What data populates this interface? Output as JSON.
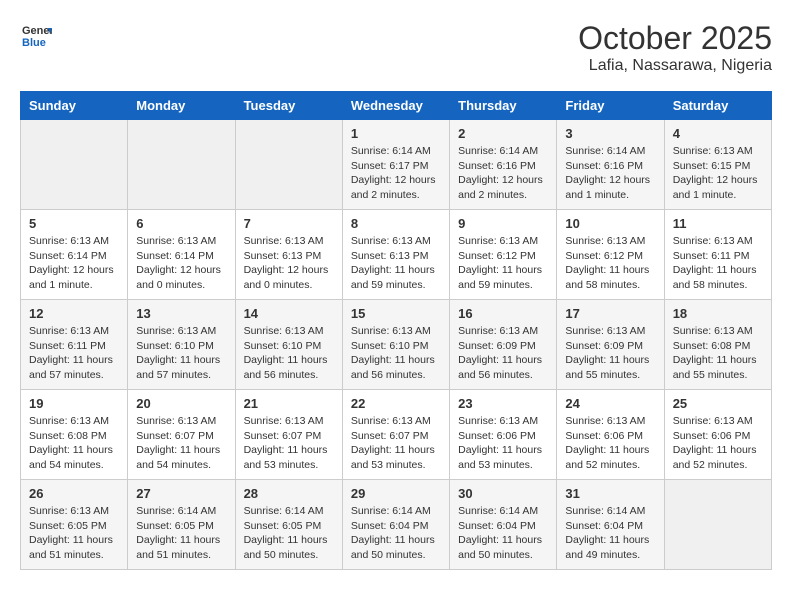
{
  "header": {
    "logo_general": "General",
    "logo_blue": "Blue",
    "title": "October 2025",
    "subtitle": "Lafia, Nassarawa, Nigeria"
  },
  "days_of_week": [
    "Sunday",
    "Monday",
    "Tuesday",
    "Wednesday",
    "Thursday",
    "Friday",
    "Saturday"
  ],
  "weeks": [
    [
      {
        "day": "",
        "info": ""
      },
      {
        "day": "",
        "info": ""
      },
      {
        "day": "",
        "info": ""
      },
      {
        "day": "1",
        "info": "Sunrise: 6:14 AM\nSunset: 6:17 PM\nDaylight: 12 hours\nand 2 minutes."
      },
      {
        "day": "2",
        "info": "Sunrise: 6:14 AM\nSunset: 6:16 PM\nDaylight: 12 hours\nand 2 minutes."
      },
      {
        "day": "3",
        "info": "Sunrise: 6:14 AM\nSunset: 6:16 PM\nDaylight: 12 hours\nand 1 minute."
      },
      {
        "day": "4",
        "info": "Sunrise: 6:13 AM\nSunset: 6:15 PM\nDaylight: 12 hours\nand 1 minute."
      }
    ],
    [
      {
        "day": "5",
        "info": "Sunrise: 6:13 AM\nSunset: 6:14 PM\nDaylight: 12 hours\nand 1 minute."
      },
      {
        "day": "6",
        "info": "Sunrise: 6:13 AM\nSunset: 6:14 PM\nDaylight: 12 hours\nand 0 minutes."
      },
      {
        "day": "7",
        "info": "Sunrise: 6:13 AM\nSunset: 6:13 PM\nDaylight: 12 hours\nand 0 minutes."
      },
      {
        "day": "8",
        "info": "Sunrise: 6:13 AM\nSunset: 6:13 PM\nDaylight: 11 hours\nand 59 minutes."
      },
      {
        "day": "9",
        "info": "Sunrise: 6:13 AM\nSunset: 6:12 PM\nDaylight: 11 hours\nand 59 minutes."
      },
      {
        "day": "10",
        "info": "Sunrise: 6:13 AM\nSunset: 6:12 PM\nDaylight: 11 hours\nand 58 minutes."
      },
      {
        "day": "11",
        "info": "Sunrise: 6:13 AM\nSunset: 6:11 PM\nDaylight: 11 hours\nand 58 minutes."
      }
    ],
    [
      {
        "day": "12",
        "info": "Sunrise: 6:13 AM\nSunset: 6:11 PM\nDaylight: 11 hours\nand 57 minutes."
      },
      {
        "day": "13",
        "info": "Sunrise: 6:13 AM\nSunset: 6:10 PM\nDaylight: 11 hours\nand 57 minutes."
      },
      {
        "day": "14",
        "info": "Sunrise: 6:13 AM\nSunset: 6:10 PM\nDaylight: 11 hours\nand 56 minutes."
      },
      {
        "day": "15",
        "info": "Sunrise: 6:13 AM\nSunset: 6:10 PM\nDaylight: 11 hours\nand 56 minutes."
      },
      {
        "day": "16",
        "info": "Sunrise: 6:13 AM\nSunset: 6:09 PM\nDaylight: 11 hours\nand 56 minutes."
      },
      {
        "day": "17",
        "info": "Sunrise: 6:13 AM\nSunset: 6:09 PM\nDaylight: 11 hours\nand 55 minutes."
      },
      {
        "day": "18",
        "info": "Sunrise: 6:13 AM\nSunset: 6:08 PM\nDaylight: 11 hours\nand 55 minutes."
      }
    ],
    [
      {
        "day": "19",
        "info": "Sunrise: 6:13 AM\nSunset: 6:08 PM\nDaylight: 11 hours\nand 54 minutes."
      },
      {
        "day": "20",
        "info": "Sunrise: 6:13 AM\nSunset: 6:07 PM\nDaylight: 11 hours\nand 54 minutes."
      },
      {
        "day": "21",
        "info": "Sunrise: 6:13 AM\nSunset: 6:07 PM\nDaylight: 11 hours\nand 53 minutes."
      },
      {
        "day": "22",
        "info": "Sunrise: 6:13 AM\nSunset: 6:07 PM\nDaylight: 11 hours\nand 53 minutes."
      },
      {
        "day": "23",
        "info": "Sunrise: 6:13 AM\nSunset: 6:06 PM\nDaylight: 11 hours\nand 53 minutes."
      },
      {
        "day": "24",
        "info": "Sunrise: 6:13 AM\nSunset: 6:06 PM\nDaylight: 11 hours\nand 52 minutes."
      },
      {
        "day": "25",
        "info": "Sunrise: 6:13 AM\nSunset: 6:06 PM\nDaylight: 11 hours\nand 52 minutes."
      }
    ],
    [
      {
        "day": "26",
        "info": "Sunrise: 6:13 AM\nSunset: 6:05 PM\nDaylight: 11 hours\nand 51 minutes."
      },
      {
        "day": "27",
        "info": "Sunrise: 6:14 AM\nSunset: 6:05 PM\nDaylight: 11 hours\nand 51 minutes."
      },
      {
        "day": "28",
        "info": "Sunrise: 6:14 AM\nSunset: 6:05 PM\nDaylight: 11 hours\nand 50 minutes."
      },
      {
        "day": "29",
        "info": "Sunrise: 6:14 AM\nSunset: 6:04 PM\nDaylight: 11 hours\nand 50 minutes."
      },
      {
        "day": "30",
        "info": "Sunrise: 6:14 AM\nSunset: 6:04 PM\nDaylight: 11 hours\nand 50 minutes."
      },
      {
        "day": "31",
        "info": "Sunrise: 6:14 AM\nSunset: 6:04 PM\nDaylight: 11 hours\nand 49 minutes."
      },
      {
        "day": "",
        "info": ""
      }
    ]
  ]
}
